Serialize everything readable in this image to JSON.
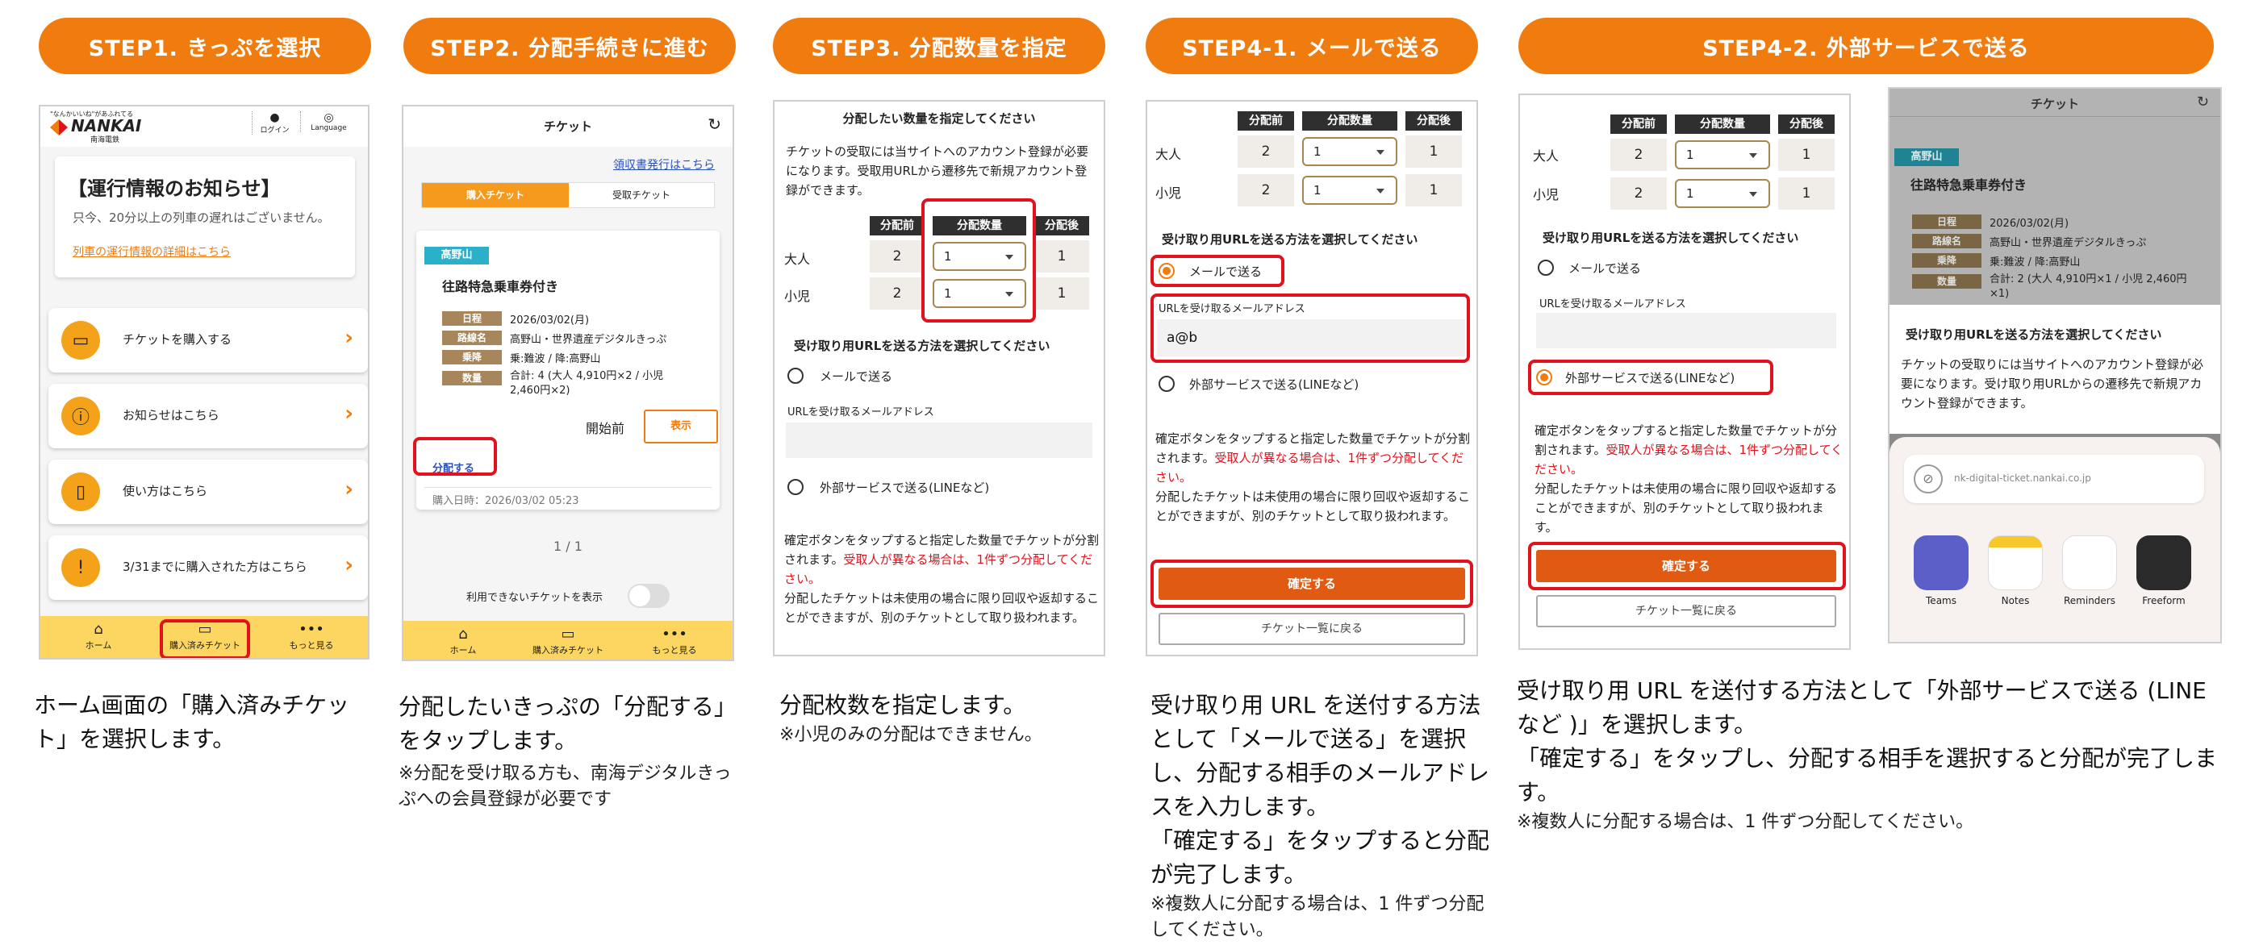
{
  "steps": [
    {
      "label": "STEP1. きっぷを選択"
    },
    {
      "label": "STEP2. 分配手続きに進む"
    },
    {
      "label": "STEP3. 分配数量を指定"
    },
    {
      "label": "STEP4-1. メールで送る"
    },
    {
      "label": "STEP4-2. 外部サービスで送る"
    }
  ],
  "captions": {
    "s1": "ホーム画面の「購入済みチケット」を選択します。",
    "s2": "分配したいきっぷの「分配する」をタップします。",
    "s2_note": "※分配を受け取る方も、南海デジタルきっぷへの会員登録が必要です",
    "s3": "分配枚数を指定します。",
    "s3_note": "※小児のみの分配はできません。",
    "s41": "受け取り用 URL を送付する方法として「メールで送る」を選択し、分配する相手のメールアドレスを入力します。",
    "s41b": "「確定する」をタップすると分配が完了します。",
    "s41_note": "※複数人に分配する場合は、1 件ずつ分配してください。",
    "s42": "受け取り用 URL を送付する方法として「外部サービスで送る (LINE など )」を選択します。",
    "s42b": "「確定する」をタップし、分配する相手を選択すると分配が完了します。",
    "s42_note": "※複数人に分配する場合は、1 件ずつ分配してください。"
  },
  "s1": {
    "logo_small": "\"なんかいいね\"があふれてる",
    "logo": "NANKAI",
    "logo_sub": "南海電鉄",
    "login": "ログイン",
    "language": "Language",
    "notice_title": "【運行情報のお知らせ】",
    "notice_text": "只今、20分以上の列車の遅れはございません。",
    "notice_link": "列車の運行情報の詳細はこちら",
    "menu": [
      "チケットを購入する",
      "お知らせはこちら",
      "使い方はこちら",
      "3/31までに購入された方はこちら"
    ],
    "nav": [
      "ホーム",
      "購入済みチケット",
      "もっと見る"
    ]
  },
  "s2": {
    "title": "チケット",
    "receipt": "領収書発行はこちら",
    "tab_buy": "購入チケット",
    "tab_recv": "受取チケット",
    "badge": "高野山",
    "ticket_name": "往路特急乗車券付き",
    "rows": [
      {
        "k": "日程",
        "v": "2026/03/02(月)"
      },
      {
        "k": "路線名",
        "v": "高野山・世界遺産デジタルきっぷ"
      },
      {
        "k": "乗降",
        "v": "乗:難波 / 降:高野山"
      },
      {
        "k": "数量",
        "v": "合計: 4 (大人 4,910円×2 / 小児 2,460円×2)"
      }
    ],
    "status": "開始前",
    "show": "表示",
    "split": "分配する",
    "purchase": "購入日時：2026/03/02 05:23",
    "pager": "1 / 1",
    "unusable": "利用できないチケットを表示",
    "nav": [
      "ホーム",
      "購入済みチケット",
      "もっと見る"
    ]
  },
  "table": {
    "h_before": "分配前",
    "h_qty": "分配数量",
    "h_after": "分配後",
    "adult": "大人",
    "child": "小児",
    "before": "2",
    "qty": "1",
    "after": "1"
  },
  "form": {
    "method_q": "受け取り用URLを送る方法を選択してください",
    "mail": "メールで送る",
    "email_label": "URLを受け取るメールアドレス",
    "email_value": "a@b",
    "external": "外部サービスで送る(LINEなど)",
    "info1": "確定ボタンをタップすると指定した数量でチケットが分割されます。",
    "info_red": "受取人が異なる場合は、1件ずつ分配してください。",
    "info2": "分配したチケットは未使用の場合に限り回収や返却することができますが、別のチケットとして取り扱われます。",
    "confirm": "確定する",
    "back": "チケット一覧に戻る"
  },
  "s3": {
    "head": "分配したい数量を指定してください",
    "desc": "チケットの受取には当サイトへのアカウント登録が必要になります。受取用URLから遷移先で新規アカウント登録ができます。"
  },
  "s42b": {
    "title": "チケット",
    "badge": "高野山",
    "ticket_name": "往路特急乗車券付き",
    "rows": [
      {
        "k": "日程",
        "v": "2026/03/02(月)"
      },
      {
        "k": "路線名",
        "v": "高野山・世界遺産デジタルきっぷ"
      },
      {
        "k": "乗降",
        "v": "乗:難波 / 降:高野山"
      },
      {
        "k": "数量",
        "v": "合計: 2 (大人 4,910円×1 / 小児 2,460円×1)"
      }
    ],
    "sheet_head": "受け取り用URLを送る方法を選択してください",
    "sheet_text": "チケットの受取りには当サイトへのアカウント登録が必要になります。受け取り用URLからの遷移先で新規アカウント登録ができます。",
    "share_url": "nk-digital-ticket.nankai.co.jp",
    "apps": [
      "Teams",
      "Notes",
      "Reminders",
      "Freeform"
    ]
  }
}
